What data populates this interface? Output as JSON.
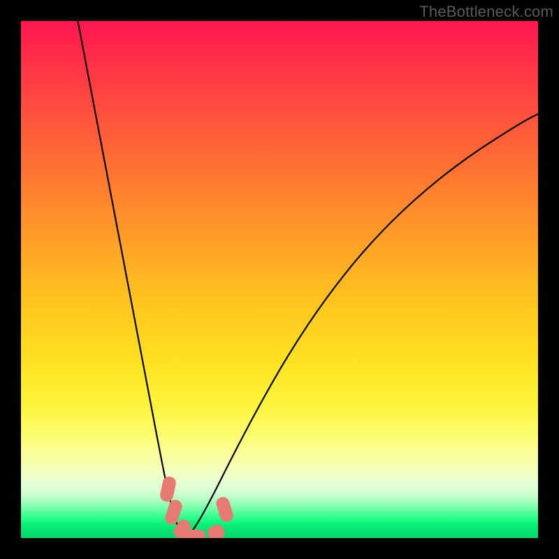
{
  "watermark": "TheBottleneck.com",
  "colors": {
    "frame_bg": "#000000",
    "curve": "#000000",
    "marker": "#e77b73",
    "watermark": "#5a5a5a",
    "gradient_stops": [
      "#ff1550",
      "#ff2a49",
      "#ff4a3f",
      "#ff6a35",
      "#ff8a2c",
      "#ffab24",
      "#ffc91e",
      "#ffe222",
      "#fff43a",
      "#fcfd6e",
      "#fbfe97",
      "#f6ffb4",
      "#efffc7",
      "#e4ffd1",
      "#d4ffd3",
      "#bcffc9",
      "#9cffba",
      "#77ffaa",
      "#4fff9a",
      "#28ff8a",
      "#0cf57a",
      "#07e773",
      "#05df6f",
      "#05db6d"
    ]
  },
  "chart_data": {
    "type": "line",
    "title": "",
    "xlabel": "",
    "ylabel": "",
    "xlim": [
      0,
      100
    ],
    "ylim": [
      0,
      100
    ],
    "grid": false,
    "legend": false,
    "series": [
      {
        "name": "left-branch",
        "x": [
          11.0,
          13.0,
          15.0,
          17.0,
          19.0,
          21.0,
          23.0,
          25.0,
          27.0,
          28.5,
          30.0,
          31.0,
          32.0
        ],
        "y": [
          100.0,
          89.5,
          79.0,
          68.5,
          58.0,
          47.5,
          37.0,
          26.5,
          16.0,
          8.5,
          3.0,
          1.0,
          0.0
        ]
      },
      {
        "name": "right-branch",
        "x": [
          32.0,
          34.0,
          37.0,
          41.0,
          46.0,
          52.0,
          59.0,
          67.0,
          76.0,
          86.0,
          97.0,
          100.0
        ],
        "y": [
          0.0,
          2.5,
          8.0,
          16.0,
          25.5,
          36.0,
          46.5,
          56.5,
          65.5,
          73.5,
          80.5,
          82.0
        ]
      }
    ],
    "markers": [
      {
        "x": 28.4,
        "y": 9.5,
        "w": 2.6,
        "h": 4.8,
        "angle": 12
      },
      {
        "x": 29.6,
        "y": 5.0,
        "w": 2.6,
        "h": 4.8,
        "angle": 18
      },
      {
        "x": 31.2,
        "y": 1.8,
        "w": 2.6,
        "h": 3.8,
        "angle": 35
      },
      {
        "x": 33.4,
        "y": 0.3,
        "w": 4.6,
        "h": 2.6,
        "angle": 0
      },
      {
        "x": 37.7,
        "y": 1.0,
        "w": 3.2,
        "h": 2.8,
        "angle": -25
      },
      {
        "x": 39.4,
        "y": 5.6,
        "w": 2.6,
        "h": 4.8,
        "angle": -18
      }
    ]
  }
}
